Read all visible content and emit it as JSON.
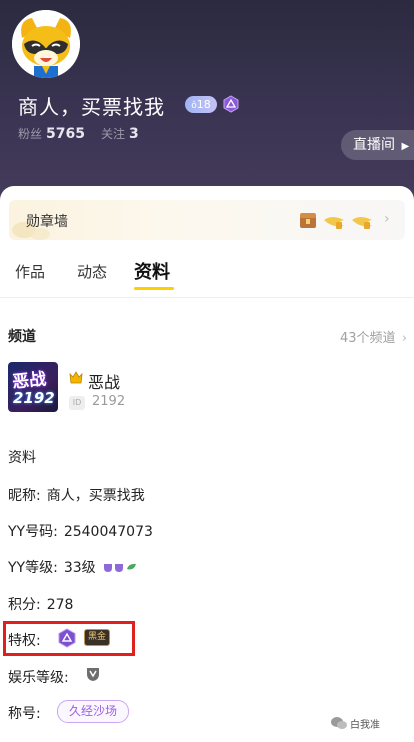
{
  "profile": {
    "nickname": "商人，买票找我",
    "level_badge": "18",
    "fans_label": "粉丝",
    "fans_count": "5765",
    "follow_label": "关注",
    "follow_count": "3",
    "live_button": "直播间"
  },
  "medal_wall": {
    "label": "勋章墙"
  },
  "tabs": [
    "作品",
    "动态",
    "资料"
  ],
  "channel": {
    "section_title": "频道",
    "count_text": "43个频道",
    "thumb_text_top": "恶战",
    "thumb_text_bottom": "2192",
    "name": "恶战",
    "id_label": "ID",
    "id": "2192"
  },
  "info": {
    "section_title": "资料",
    "nickname_label": "昵称:",
    "nickname_value": "商人，买票找我",
    "yy_label": "YY号码:",
    "yy_value": "2540047073",
    "level_label": "YY等级:",
    "level_value": "33级",
    "points_label": "积分:",
    "points_value": "278",
    "privilege_label": "特权:",
    "privilege_card": "黑金",
    "ent_level_label": "娱乐等级:",
    "title_label": "称号:",
    "title_value": "久经沙场"
  },
  "watermark": "白我准",
  "colors": {
    "accent": "#ffcf00",
    "header": "#3a3452",
    "highlight_box": "#e0201e",
    "title_purple": "#9a60e6"
  },
  "icons": [
    "raccoon-avatar",
    "purple-hexagon-badge",
    "medal-chest-icon",
    "medal-wing-icon",
    "chevron-right-icon",
    "crown-icon",
    "level-shield-icons",
    "black-gold-card-icon",
    "ent-level-icon",
    "wechat-logo"
  ]
}
